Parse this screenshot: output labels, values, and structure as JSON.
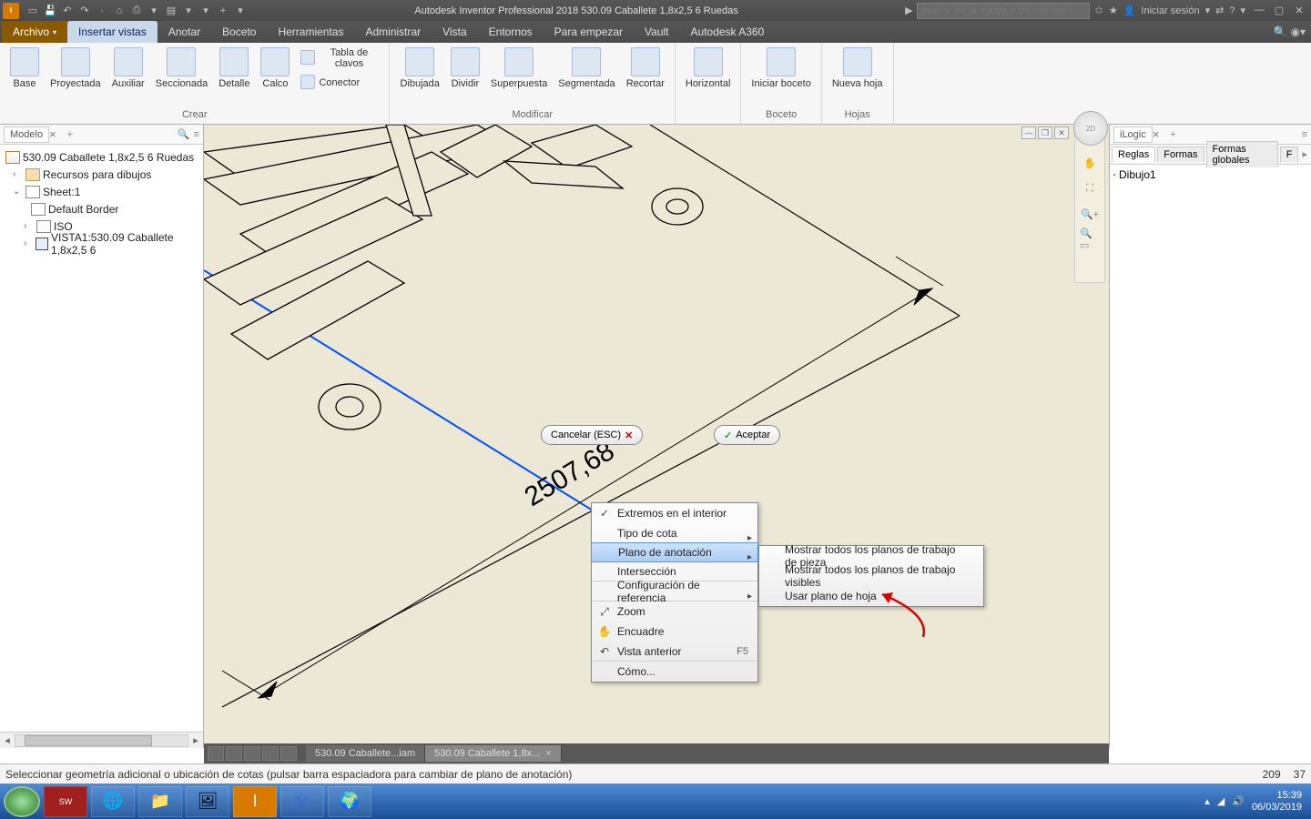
{
  "title": "Autodesk Inventor Professional 2018   530.09 Caballete 1,8x2,5  6 Ruedas",
  "search_placeholder": "Buscar en la ayuda y los comanc",
  "signin": "Iniciar sesión",
  "tabs": {
    "file": "Archivo",
    "active": "Insertar vistas",
    "others": [
      "Anotar",
      "Boceto",
      "Herramientas",
      "Administrar",
      "Vista",
      "Entornos",
      "Para empezar",
      "Vault",
      "Autodesk A360"
    ]
  },
  "ribbon": {
    "panel1": {
      "title": "Crear",
      "big": [
        {
          "label": "Base"
        },
        {
          "label": "Proyectada"
        },
        {
          "label": "Auxiliar"
        },
        {
          "label": "Seccionada"
        },
        {
          "label": "Detalle"
        },
        {
          "label": "Calco"
        }
      ],
      "small": [
        {
          "label": "Tabla de clavos"
        },
        {
          "label": "Conector"
        }
      ]
    },
    "panel2": {
      "title": "Modificar",
      "big": [
        {
          "label": "Dibujada"
        },
        {
          "label": "Dividir"
        },
        {
          "label": "Superpuesta"
        },
        {
          "label": "Segmentada"
        },
        {
          "label": "Recortar"
        }
      ]
    },
    "panel3": {
      "title": "",
      "big": [
        {
          "label": "Horizontal"
        }
      ]
    },
    "panel4": {
      "title": "Boceto",
      "big": [
        {
          "label": "Iniciar boceto"
        }
      ]
    },
    "panel5": {
      "title": "Hojas",
      "big": [
        {
          "label": "Nueva hoja"
        }
      ]
    }
  },
  "leftPanel": {
    "tab": "Modelo",
    "root": "530.09 Caballete 1,8x2,5  6 Ruedas",
    "items": [
      "Recursos para dibujos",
      "Sheet:1",
      "Default Border",
      "ISO",
      "VISTA1:530.09 Caballete 1,8x2,5  6"
    ]
  },
  "canvas": {
    "dimension": "2507,68",
    "cancel": "Cancelar (ESC)",
    "accept": "Aceptar"
  },
  "context1": [
    {
      "label": "Extremos en el interior",
      "check": true
    },
    {
      "label": "Tipo de cota",
      "sub": true,
      "sep": true
    },
    {
      "label": "Plano de anotación",
      "sub": true,
      "hi": true
    },
    {
      "label": "Intersección",
      "sep": true
    },
    {
      "label": "Configuración de referencia",
      "sub": true,
      "sep": true
    },
    {
      "label": "Zoom",
      "icon": "⤢"
    },
    {
      "label": "Encuadre",
      "icon": "✋"
    },
    {
      "label": "Vista anterior",
      "icon": "↶",
      "sc": "F5",
      "sep": true
    },
    {
      "label": "Cómo..."
    }
  ],
  "context2": [
    "Mostrar todos los planos de trabajo de pieza",
    "Mostrar todos los planos de trabajo visibles",
    "Usar plano de hoja"
  ],
  "rightPanel": {
    "tab": "iLogic",
    "subtabs": [
      "Reglas",
      "Formas",
      "Formas globales",
      "F"
    ],
    "item": "Dibujo1"
  },
  "docTabs": [
    {
      "label": "530.09 Caballete...iam"
    },
    {
      "label": "530.09 Caballete 1,8x...",
      "active": true
    }
  ],
  "status": {
    "text": "Seleccionar geometría adicional o ubicación de cotas (pulsar barra espaciadora para cambiar de plano de anotación)",
    "n1": "209",
    "n2": "37"
  },
  "taskbar": {
    "time": "15:39",
    "date": "06/03/2019"
  }
}
